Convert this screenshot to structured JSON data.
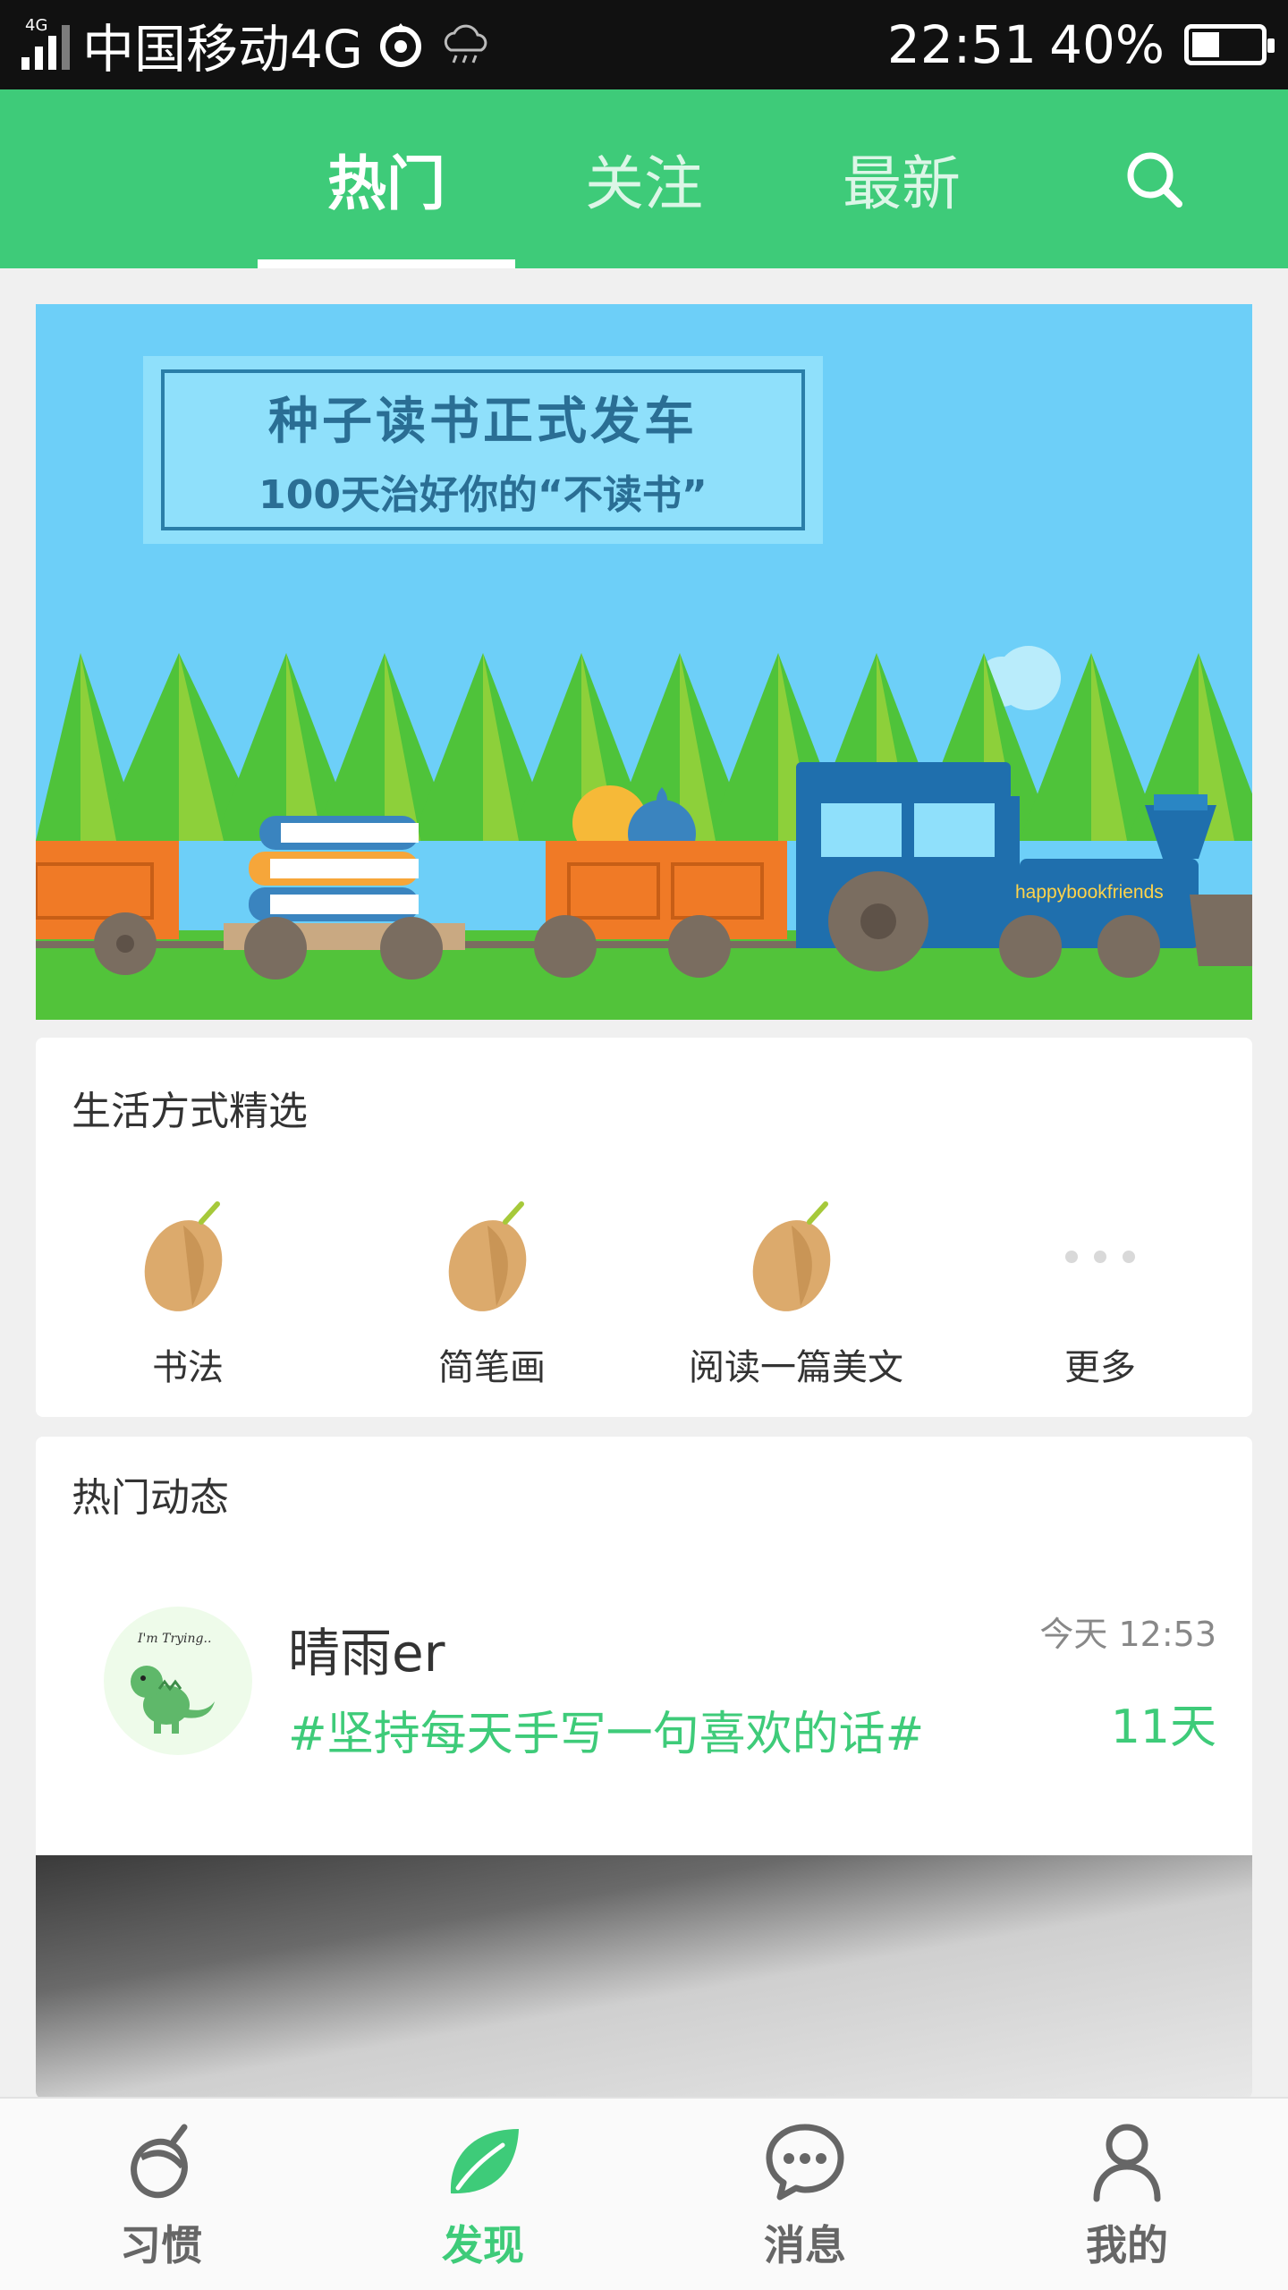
{
  "status_bar": {
    "network_badge": "4G",
    "carrier": "中国移动4G",
    "time": "22:51",
    "battery_percent": "40%",
    "battery_level": 0.4,
    "icons": [
      "signal-icon",
      "hotspot-icon",
      "weather-rain-icon",
      "battery-icon"
    ]
  },
  "tabs": [
    {
      "label": "热门",
      "active": true
    },
    {
      "label": "关注",
      "active": false
    },
    {
      "label": "最新",
      "active": false
    }
  ],
  "search_icon": "search-icon",
  "banner": {
    "headline": "种子读书正式发车",
    "subline": "100天治好你的“不读书”",
    "train_text": "happybookfriends"
  },
  "lifestyle": {
    "title": "生活方式精选",
    "items": [
      {
        "label": "书法",
        "icon": "seed-icon"
      },
      {
        "label": "简笔画",
        "icon": "seed-icon"
      },
      {
        "label": "阅读一篇美文",
        "icon": "seed-icon"
      },
      {
        "label": "更多",
        "icon": "more-icon"
      }
    ]
  },
  "feed": {
    "title": "热门动态",
    "post": {
      "username": "晴雨er",
      "time": "今天 12:53",
      "habit": "#坚持每天手写一句喜欢的话#",
      "streak": "11天",
      "avatar_text": "I'm Trying.."
    }
  },
  "bottom_nav": [
    {
      "label": "习惯",
      "icon": "acorn-icon",
      "active": false
    },
    {
      "label": "发现",
      "icon": "leaf-icon",
      "active": true
    },
    {
      "label": "消息",
      "icon": "chat-bubble-icon",
      "active": false
    },
    {
      "label": "我的",
      "icon": "person-icon",
      "active": false
    }
  ],
  "colors": {
    "brand_green": "#3ecb79",
    "status_bar": "#111111",
    "banner_sky": "#6dcff8"
  }
}
